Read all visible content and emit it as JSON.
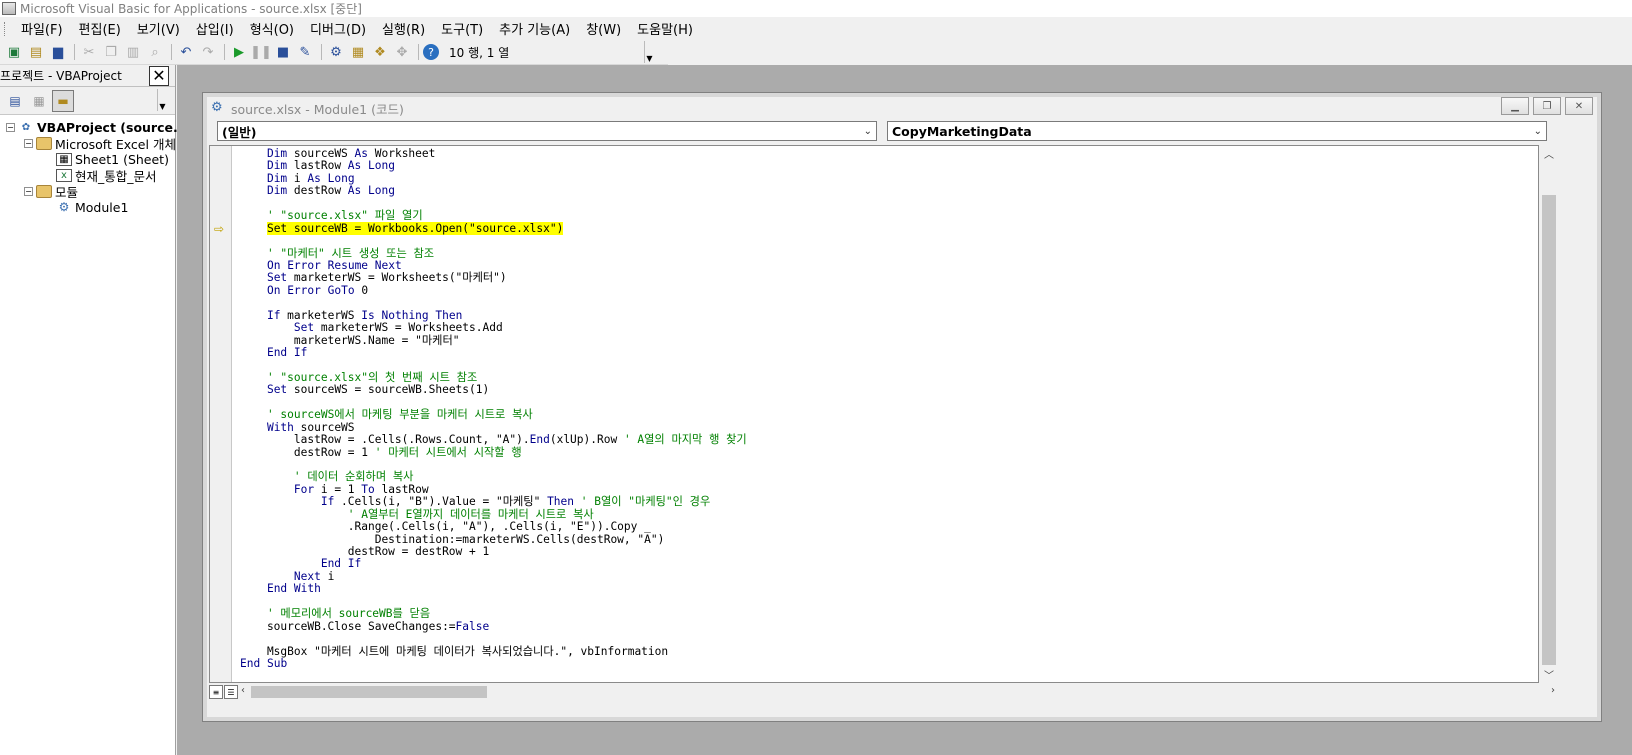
{
  "window": {
    "title": "Microsoft Visual Basic for Applications - source.xlsx [중단]"
  },
  "menu": [
    "파일(F)",
    "편집(E)",
    "보기(V)",
    "삽입(I)",
    "형식(O)",
    "디버그(D)",
    "실행(R)",
    "도구(T)",
    "추가 기능(A)",
    "창(W)",
    "도움말(H)"
  ],
  "toolbar": {
    "cursor_position": "10 행, 1 열",
    "icons": [
      "excel-icon",
      "insert-module-icon",
      "save-icon",
      "cut-icon",
      "copy-icon",
      "paste-icon",
      "find-icon",
      "undo-icon",
      "redo-icon",
      "run-icon",
      "pause-icon",
      "reset-icon",
      "design-mode-icon",
      "project-explorer-icon",
      "properties-icon",
      "object-browser-icon",
      "toolbox-icon",
      "help-icon"
    ]
  },
  "project": {
    "title": "프로젝트 - VBAProject",
    "close": "✕",
    "tree": [
      {
        "label": "VBAProject (source.",
        "bold": true
      },
      {
        "label": "Microsoft Excel 개체"
      },
      {
        "label": "Sheet1 (Sheet)"
      },
      {
        "label": "현재_통합_문서"
      },
      {
        "label": "모듈"
      },
      {
        "label": "Module1"
      }
    ]
  },
  "code_window": {
    "title": "source.xlsx - Module1 (코드)",
    "object_dropdown": "(일반)",
    "procedure_dropdown": "CopyMarketingData",
    "execution_line": 7,
    "lines": [
      "    Dim sourceWS As Worksheet",
      "    Dim lastRow As Long",
      "    Dim i As Long",
      "    Dim destRow As Long",
      "",
      "    ' \"source.xlsx\" 파일 열기",
      "    Set sourceWB = Workbooks.Open(\"source.xlsx\")",
      "",
      "    ' \"마케터\" 시트 생성 또는 참조",
      "    On Error Resume Next",
      "    Set marketerWS = Worksheets(\"마케터\")",
      "    On Error GoTo 0",
      "",
      "    If marketerWS Is Nothing Then",
      "        Set marketerWS = Worksheets.Add",
      "        marketerWS.Name = \"마케터\"",
      "    End If",
      "",
      "    ' \"source.xlsx\"의 첫 번째 시트 참조",
      "    Set sourceWS = sourceWB.Sheets(1)",
      "",
      "    ' sourceWS에서 마케팅 부분을 마케터 시트로 복사",
      "    With sourceWS",
      "        lastRow = .Cells(.Rows.Count, \"A\").End(xlUp).Row ' A열의 마지막 행 찾기",
      "        destRow = 1 ' 마케터 시트에서 시작할 행",
      "",
      "        ' 데이터 순회하며 복사",
      "        For i = 1 To lastRow",
      "            If .Cells(i, \"B\").Value = \"마케팅\" Then ' B열이 \"마케팅\"인 경우",
      "                ' A열부터 E열까지 데이터를 마케터 시트로 복사",
      "                .Range(.Cells(i, \"A\"), .Cells(i, \"E\")).Copy _",
      "                    Destination:=marketerWS.Cells(destRow, \"A\")",
      "                destRow = destRow + 1",
      "            End If",
      "        Next i",
      "    End With",
      "",
      "    ' 메모리에서 sourceWB를 닫음",
      "    sourceWB.Close SaveChanges:=False",
      "",
      "    MsgBox \"마케터 시트에 마케팅 데이터가 복사되었습니다.\", vbInformation",
      "End Sub"
    ]
  },
  "colors": {
    "keyword": "#00008b",
    "comment": "#008000",
    "highlight": "#ffff00",
    "workspace": "#ababab"
  }
}
